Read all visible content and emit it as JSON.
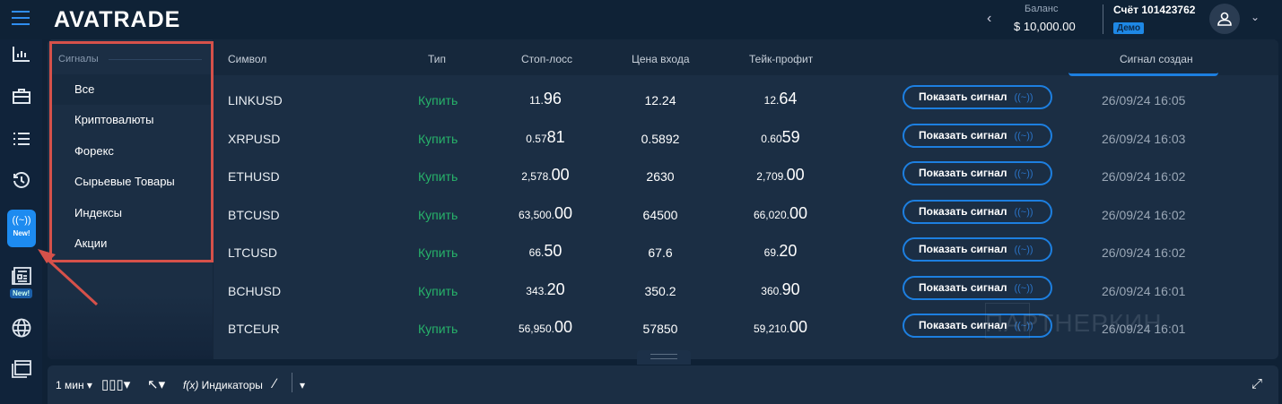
{
  "header": {
    "logo": "AVATRADE",
    "balance_label": "Баланс",
    "balance_value": "$ 10,000.00",
    "account": "Счёт 101423762",
    "account_type": "Демо"
  },
  "rail": {
    "new_badge": "New!",
    "new_badge2": "New!"
  },
  "sidebar": {
    "title": "Сигналы",
    "items": [
      {
        "label": "Все"
      },
      {
        "label": "Криптовалюты"
      },
      {
        "label": "Форекс"
      },
      {
        "label": "Сырьевые Товары"
      },
      {
        "label": "Индексы"
      },
      {
        "label": "Акции"
      }
    ]
  },
  "table": {
    "headers": {
      "symbol": "Символ",
      "type": "Тип",
      "stop_loss": "Стоп-лосс",
      "entry": "Цена входа",
      "take_profit": "Тейк-профит",
      "created": "Сигнал создан"
    },
    "button_label": "Показать сигнал",
    "button_icon": "((~))",
    "rows": [
      {
        "symbol": "LINKUSD",
        "type": "Купить",
        "sl": [
          "11.",
          "96"
        ],
        "entry": "12.24",
        "tp": [
          "12.",
          "64"
        ],
        "created": "26/09/24 16:05"
      },
      {
        "symbol": "XRPUSD",
        "type": "Купить",
        "sl": [
          "0.57",
          "81"
        ],
        "entry": "0.5892",
        "tp": [
          "0.60",
          "59"
        ],
        "created": "26/09/24 16:03"
      },
      {
        "symbol": "ETHUSD",
        "type": "Купить",
        "sl": [
          "2,578.",
          "00"
        ],
        "entry": "2630",
        "tp": [
          "2,709.",
          "00"
        ],
        "created": "26/09/24 16:02"
      },
      {
        "symbol": "BTCUSD",
        "type": "Купить",
        "sl": [
          "63,500.",
          "00"
        ],
        "entry": "64500",
        "tp": [
          "66,020.",
          "00"
        ],
        "created": "26/09/24 16:02"
      },
      {
        "symbol": "LTCUSD",
        "type": "Купить",
        "sl": [
          "66.",
          "50"
        ],
        "entry": "67.6",
        "tp": [
          "69.",
          "20"
        ],
        "created": "26/09/24 16:02"
      },
      {
        "symbol": "BCHUSD",
        "type": "Купить",
        "sl": [
          "343.",
          "20"
        ],
        "entry": "350.2",
        "tp": [
          "360.",
          "90"
        ],
        "created": "26/09/24 16:01"
      },
      {
        "symbol": "BTCEUR",
        "type": "Купить",
        "sl": [
          "56,950.",
          "00"
        ],
        "entry": "57850",
        "tp": [
          "59,210.",
          "00"
        ],
        "created": "26/09/24 16:01"
      }
    ]
  },
  "toolbar": {
    "interval": "1 мин",
    "indicators": "Индикаторы",
    "fx": "f(x)"
  },
  "watermark": "ПАРТНЕРКИН",
  "colors": {
    "accent": "#1d8bf0",
    "buy": "#27b36a",
    "highlight": "#d6514a"
  }
}
